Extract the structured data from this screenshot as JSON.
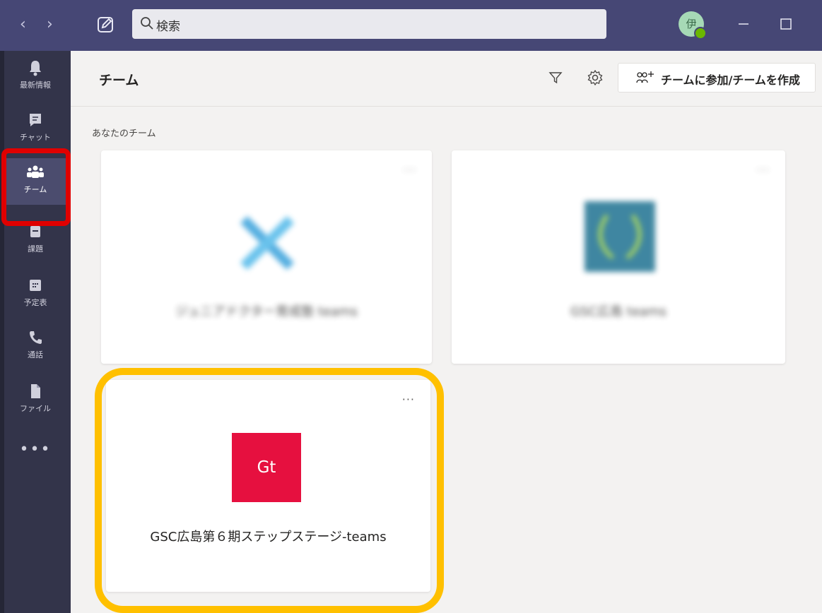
{
  "titlebar": {
    "back_icon": "chevron-left-icon",
    "forward_icon": "chevron-right-icon",
    "compose_icon": "compose-icon",
    "search_placeholder": "検索",
    "avatar_initial": "伊",
    "presence_color": "#6bb700",
    "minimize_icon": "minimize-icon",
    "maximize_icon": "maximize-icon"
  },
  "rail": {
    "items": [
      {
        "label": "最新情報",
        "icon": "bell-icon"
      },
      {
        "label": "チャット",
        "icon": "chat-icon"
      },
      {
        "label": "チーム",
        "icon": "teams-icon",
        "active": true
      },
      {
        "label": "課題",
        "icon": "assignments-icon"
      },
      {
        "label": "予定表",
        "icon": "calendar-icon"
      },
      {
        "label": "通話",
        "icon": "phone-icon"
      },
      {
        "label": "ファイル",
        "icon": "file-icon"
      }
    ],
    "more": "•••"
  },
  "header": {
    "title": "チーム",
    "join_button": "チームに参加/チームを作成"
  },
  "section_label": "あなたのチーム",
  "teams": [
    {
      "name": "ジュニアドクター育成塾 teams",
      "blurred": true,
      "menu": "···"
    },
    {
      "name": "GSC広島 teams",
      "blurred": true,
      "menu": "···"
    },
    {
      "name": "GSC広島第６期ステップステージ-teams",
      "initials": "Gt",
      "color": "#e6103f",
      "menu": "···"
    }
  ],
  "colors": {
    "titlebar": "#464775",
    "rail": "#33344a",
    "highlight_red": "#e00000",
    "highlight_yellow": "#ffc000"
  }
}
